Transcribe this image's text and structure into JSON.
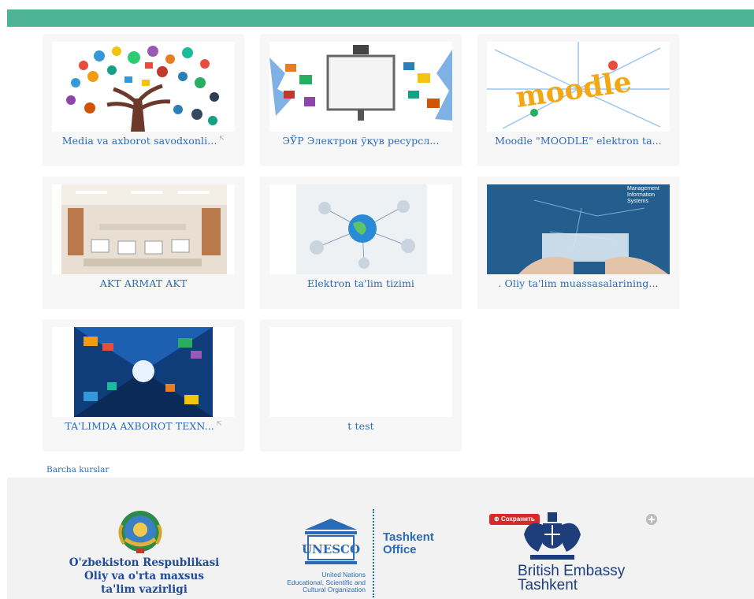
{
  "courses": [
    {
      "title": "Media va axborot savodxonli...",
      "external": true,
      "thumb": "tree-icons"
    },
    {
      "title": "ЭЎР Электрон ўқув ресурсл...",
      "external": false,
      "thumb": "interactive-board"
    },
    {
      "title": "Moodle \"MOODLE\" elektron ta...",
      "external": false,
      "thumb": "moodle-logo"
    },
    {
      "title": "AKT ARMAT AKT",
      "external": false,
      "thumb": "library-room"
    },
    {
      "title": "Elektron ta'lim tizimi",
      "external": false,
      "thumb": "globe-network"
    },
    {
      "title": ". Oliy ta'lim muassasalarining...",
      "external": false,
      "thumb": "management-info-systems",
      "thumb_text": "Management Information Systems"
    },
    {
      "title": "TA'LIMDA AXBOROT TEXN...",
      "external": true,
      "thumb": "tech-tunnel"
    },
    {
      "title": "t test",
      "external": false,
      "thumb": "blank"
    }
  ],
  "all_courses_link": "Barcha kurslar",
  "footer": {
    "ministry": [
      "O'zbekiston Respublikasi",
      "Oliy va o'rta maxsus",
      "ta'lim vazirligi"
    ],
    "unesco_sub": [
      "United Nations",
      "Educational, Scientific and",
      "Cultural Organization"
    ],
    "unesco_office": [
      "Tashkent",
      "Office"
    ],
    "unesco_logo_text": "UNESCO",
    "save_button": "Сохранить",
    "british": [
      "British Embassy",
      "Tashkent"
    ]
  },
  "colors": {
    "accent": "#4fb496",
    "link": "#2a6bb8",
    "card_bg": "#f7f7f7",
    "footer_bg": "#f2f2f2"
  }
}
